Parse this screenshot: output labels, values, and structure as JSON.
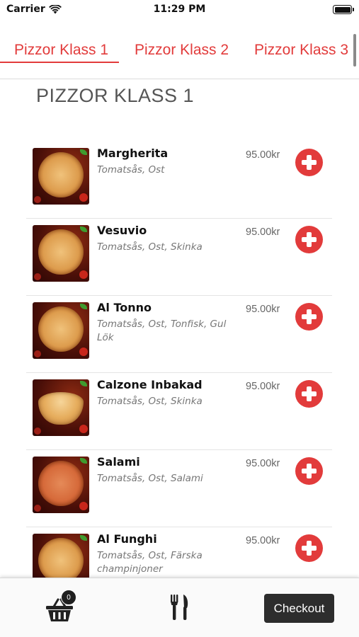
{
  "status_bar": {
    "carrier": "Carrier",
    "time": "11:29 PM"
  },
  "tabs": [
    {
      "label": "Pizzor Klass 1",
      "active": true
    },
    {
      "label": "Pizzor Klass 2",
      "active": false
    },
    {
      "label": "Pizzor Klass 3",
      "active": false
    }
  ],
  "section": {
    "title": "PIZZOR KLASS 1"
  },
  "items": [
    {
      "name": "Margherita",
      "description": "Tomatsås, Ost",
      "price": "95.00kr",
      "image_icon": "pizza-margherita-image"
    },
    {
      "name": "Vesuvio",
      "description": "Tomatsås, Ost, Skinka",
      "price": "95.00kr",
      "image_icon": "pizza-vesuvio-image"
    },
    {
      "name": "Al Tonno",
      "description": "Tomatsås, Ost, Tonfisk, Gul Lök",
      "price": "95.00kr",
      "image_icon": "pizza-al-tonno-image"
    },
    {
      "name": "Calzone Inbakad",
      "description": "Tomatsås, Ost, Skinka",
      "price": "95.00kr",
      "image_icon": "calzone-image"
    },
    {
      "name": "Salami",
      "description": "Tomatsås, Ost, Salami",
      "price": "95.00kr",
      "image_icon": "pizza-salami-image"
    },
    {
      "name": "Al Funghi",
      "description": "Tomatsås, Ost, Färska champinjoner",
      "price": "95.00kr",
      "image_icon": "pizza-al-funghi-image"
    }
  ],
  "bottom_bar": {
    "cart_count": "0",
    "checkout_label": "Checkout"
  },
  "colors": {
    "accent": "#e23b3b",
    "checkout_bg": "#2d2d2d",
    "price_text": "#666666",
    "description_text": "#777777"
  }
}
